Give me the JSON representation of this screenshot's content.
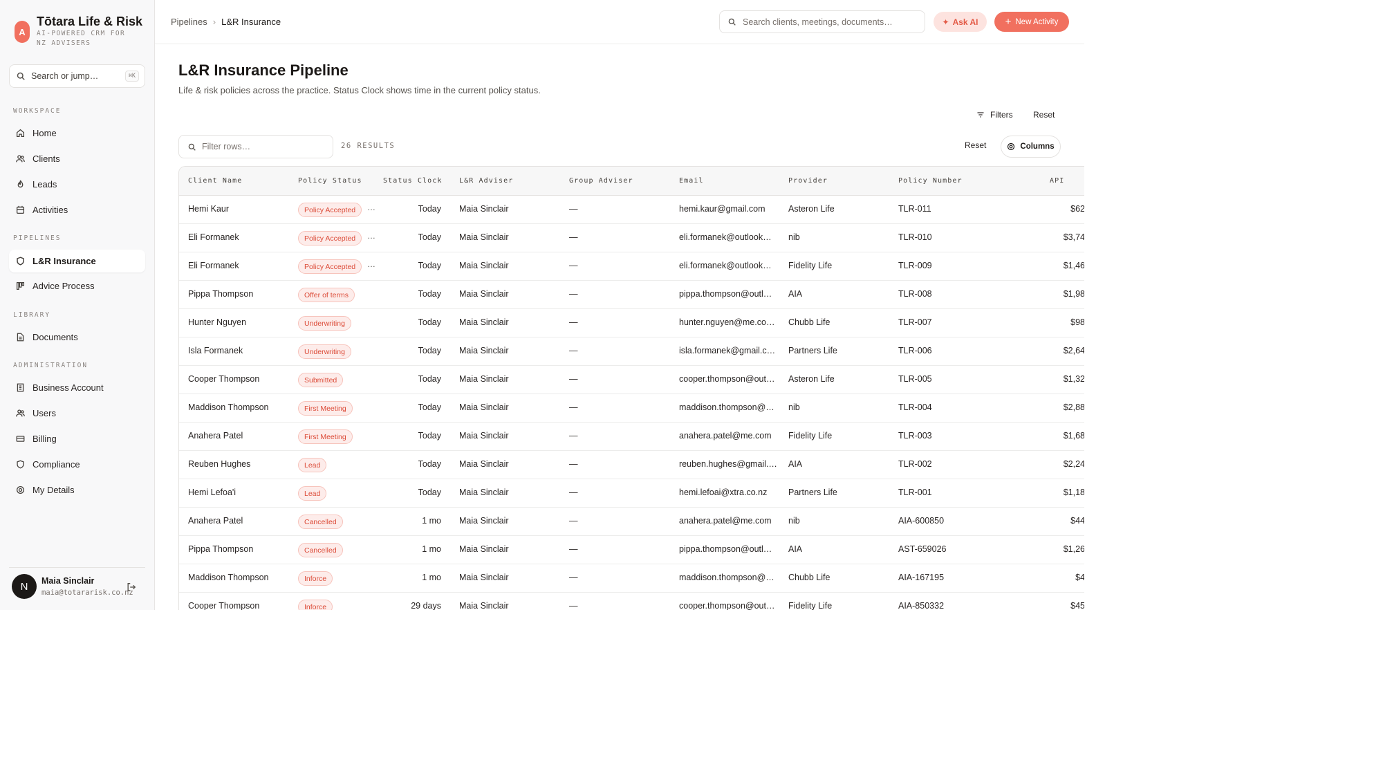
{
  "brand": {
    "logo_letter": "A",
    "title": "Tōtara Life & Risk",
    "subtitle": "AI-POWERED CRM FOR NZ ADVISERS"
  },
  "sidebar": {
    "search_placeholder": "Search or jump…",
    "search_shortcut": "⌘K",
    "sections": {
      "workspace": "WORKSPACE",
      "pipelines": "PIPELINES",
      "library": "LIBRARY",
      "administration": "ADMINISTRATION"
    },
    "items": {
      "home": "Home",
      "clients": "Clients",
      "leads": "Leads",
      "activities": "Activities",
      "lr_insurance": "L&R Insurance",
      "advice_process": "Advice Process",
      "documents": "Documents",
      "business_account": "Business Account",
      "users": "Users",
      "billing": "Billing",
      "compliance": "Compliance",
      "my_details": "My Details"
    },
    "active_item": "L&R Insurance",
    "user": {
      "avatar_letter": "N",
      "name": "Maia Sinclair",
      "email": "maia@totararisk.co.nz"
    }
  },
  "topbar": {
    "breadcrumb": [
      "Pipelines",
      "L&R Insurance"
    ],
    "search_placeholder": "Search clients, meetings, documents…",
    "ask_ai": "Ask AI",
    "new_activity": "New Activity"
  },
  "page": {
    "title": "L&R Insurance Pipeline",
    "subtitle": "Life & risk policies across the practice. Status Clock shows time in the current policy status.",
    "filters": "Filters",
    "reset": "Reset",
    "filter_placeholder": "Filter rows…",
    "results": "26 RESULTS",
    "reset_columns": "Reset",
    "columns": "Columns"
  },
  "table": {
    "headers": {
      "client_name": "Client Name",
      "policy_status": "Policy Status",
      "status_clock": "Status Clock",
      "lr_adviser": "L&R Adviser",
      "group_adviser": "Group Adviser",
      "email": "Email",
      "provider": "Provider",
      "policy_number": "Policy Number",
      "api": "API"
    },
    "rows": [
      {
        "client": "Hemi Kaur",
        "status": "Policy Accepted",
        "clock": "Today",
        "adviser": "Maia Sinclair",
        "group": "—",
        "email": "hemi.kaur@gmail.com",
        "provider": "Asteron Life",
        "policy": "TLR-011",
        "api": "$62"
      },
      {
        "client": "Eli Formanek",
        "status": "Policy Accepted",
        "clock": "Today",
        "adviser": "Maia Sinclair",
        "group": "—",
        "email": "eli.formanek@outlook…",
        "provider": "nib",
        "policy": "TLR-010",
        "api": "$3,74"
      },
      {
        "client": "Eli Formanek",
        "status": "Policy Accepted",
        "clock": "Today",
        "adviser": "Maia Sinclair",
        "group": "—",
        "email": "eli.formanek@outlook…",
        "provider": "Fidelity Life",
        "policy": "TLR-009",
        "api": "$1,46"
      },
      {
        "client": "Pippa Thompson",
        "status": "Offer of terms",
        "clock": "Today",
        "adviser": "Maia Sinclair",
        "group": "—",
        "email": "pippa.thompson@outl…",
        "provider": "AIA",
        "policy": "TLR-008",
        "api": "$1,98"
      },
      {
        "client": "Hunter Nguyen",
        "status": "Underwriting",
        "clock": "Today",
        "adviser": "Maia Sinclair",
        "group": "—",
        "email": "hunter.nguyen@me.co…",
        "provider": "Chubb Life",
        "policy": "TLR-007",
        "api": "$98"
      },
      {
        "client": "Isla Formanek",
        "status": "Underwriting",
        "clock": "Today",
        "adviser": "Maia Sinclair",
        "group": "—",
        "email": "isla.formanek@gmail.c…",
        "provider": "Partners Life",
        "policy": "TLR-006",
        "api": "$2,64"
      },
      {
        "client": "Cooper Thompson",
        "status": "Submitted",
        "clock": "Today",
        "adviser": "Maia Sinclair",
        "group": "—",
        "email": "cooper.thompson@out…",
        "provider": "Asteron Life",
        "policy": "TLR-005",
        "api": "$1,32"
      },
      {
        "client": "Maddison Thompson",
        "status": "First Meeting",
        "clock": "Today",
        "adviser": "Maia Sinclair",
        "group": "—",
        "email": "maddison.thompson@…",
        "provider": "nib",
        "policy": "TLR-004",
        "api": "$2,88"
      },
      {
        "client": "Anahera Patel",
        "status": "First Meeting",
        "clock": "Today",
        "adviser": "Maia Sinclair",
        "group": "—",
        "email": "anahera.patel@me.com",
        "provider": "Fidelity Life",
        "policy": "TLR-003",
        "api": "$1,68"
      },
      {
        "client": "Reuben Hughes",
        "status": "Lead",
        "clock": "Today",
        "adviser": "Maia Sinclair",
        "group": "—",
        "email": "reuben.hughes@gmail.…",
        "provider": "AIA",
        "policy": "TLR-002",
        "api": "$2,24"
      },
      {
        "client": "Hemi Lefoa'i",
        "status": "Lead",
        "clock": "Today",
        "adviser": "Maia Sinclair",
        "group": "—",
        "email": "hemi.lefoai@xtra.co.nz",
        "provider": "Partners Life",
        "policy": "TLR-001",
        "api": "$1,18"
      },
      {
        "client": "Anahera Patel",
        "status": "Cancelled",
        "clock": "1 mo",
        "adviser": "Maia Sinclair",
        "group": "—",
        "email": "anahera.patel@me.com",
        "provider": "nib",
        "policy": "AIA-600850",
        "api": "$44"
      },
      {
        "client": "Pippa Thompson",
        "status": "Cancelled",
        "clock": "1 mo",
        "adviser": "Maia Sinclair",
        "group": "—",
        "email": "pippa.thompson@outl…",
        "provider": "AIA",
        "policy": "AST-659026",
        "api": "$1,26"
      },
      {
        "client": "Maddison Thompson",
        "status": "Inforce",
        "clock": "1 mo",
        "adviser": "Maia Sinclair",
        "group": "—",
        "email": "maddison.thompson@…",
        "provider": "Chubb Life",
        "policy": "AIA-167195",
        "api": "$4"
      },
      {
        "client": "Cooper Thompson",
        "status": "Inforce",
        "clock": "29 days",
        "adviser": "Maia Sinclair",
        "group": "—",
        "email": "cooper.thompson@out…",
        "provider": "Fidelity Life",
        "policy": "AIA-850332",
        "api": "$45"
      }
    ]
  },
  "colors": {
    "accent": "#f1705f",
    "badge_bg": "#fdecea",
    "badge_text": "#dc4b38",
    "sidebar_bg": "#f8f8f9"
  }
}
